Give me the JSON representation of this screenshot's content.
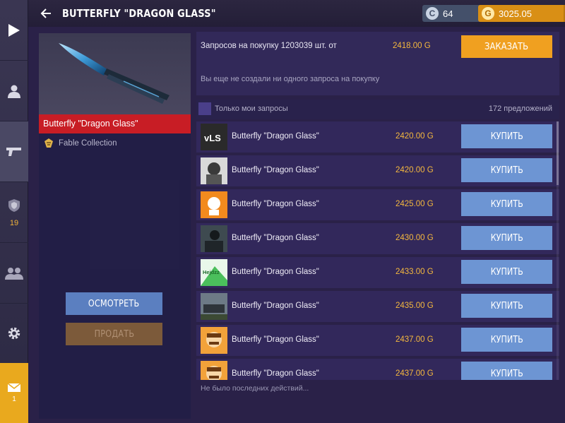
{
  "header": {
    "title": "BUTTERFLY \"DRAGON GLASS\"",
    "silver": {
      "value": "64",
      "plus": "+",
      "icon": "refresh-coin-icon"
    },
    "gold": {
      "value": "3025.05",
      "plus": "+",
      "icon": "gold-coin-icon"
    }
  },
  "sidebar": {
    "items": [
      {
        "name": "play-icon"
      },
      {
        "name": "profile-icon"
      },
      {
        "name": "weapons-icon"
      },
      {
        "name": "rank-icon",
        "count": "19"
      },
      {
        "name": "friends-icon"
      },
      {
        "name": "settings-icon"
      }
    ],
    "mail": {
      "icon": "mail-icon",
      "count": "1"
    }
  },
  "item": {
    "name": "Butterfly \"Dragon Glass\"",
    "collection": "Fable Collection",
    "inspect_label": "ОСМОТРЕТЬ",
    "sell_label": "ПРОДАТЬ"
  },
  "order": {
    "requests_text": "Запросов на покупку 1203039 шт. от",
    "requests_price": "2418.00 G",
    "order_button": "ЗАКАЗАТЬ",
    "empty_text": "Вы еще не создали ни одного запроса на покупку"
  },
  "filter": {
    "my_requests_label": "Только мои запросы",
    "offers_count": "172 предложений"
  },
  "listings": [
    {
      "name": "Butterfly \"Dragon Glass\"",
      "price": "2420.00 G",
      "buy": "КУПИТЬ",
      "thumb_text": "vLS"
    },
    {
      "name": "Butterfly \"Dragon Glass\"",
      "price": "2420.00 G",
      "buy": "КУПИТЬ",
      "thumb_text": ""
    },
    {
      "name": "Butterfly \"Dragon Glass\"",
      "price": "2425.00 G",
      "buy": "КУПИТЬ",
      "thumb_text": ""
    },
    {
      "name": "Butterfly \"Dragon Glass\"",
      "price": "2430.00 G",
      "buy": "КУПИТЬ",
      "thumb_text": ""
    },
    {
      "name": "Butterfly \"Dragon Glass\"",
      "price": "2433.00 G",
      "buy": "КУПИТЬ",
      "thumb_text": "Hejdzz"
    },
    {
      "name": "Butterfly \"Dragon Glass\"",
      "price": "2435.00 G",
      "buy": "КУПИТЬ",
      "thumb_text": ""
    },
    {
      "name": "Butterfly \"Dragon Glass\"",
      "price": "2437.00 G",
      "buy": "КУПИТЬ",
      "thumb_text": ""
    },
    {
      "name": "Butterfly \"Dragon Glass\"",
      "price": "2437.00 G",
      "buy": "КУПИТЬ",
      "thumb_text": ""
    }
  ],
  "footer": {
    "recent_actions": "Не было последних действий..."
  },
  "colors": {
    "accent_red": "#c81d25",
    "gold": "#f5b83e",
    "buy_blue": "#6d95d3",
    "order_orange": "#f0a020"
  }
}
